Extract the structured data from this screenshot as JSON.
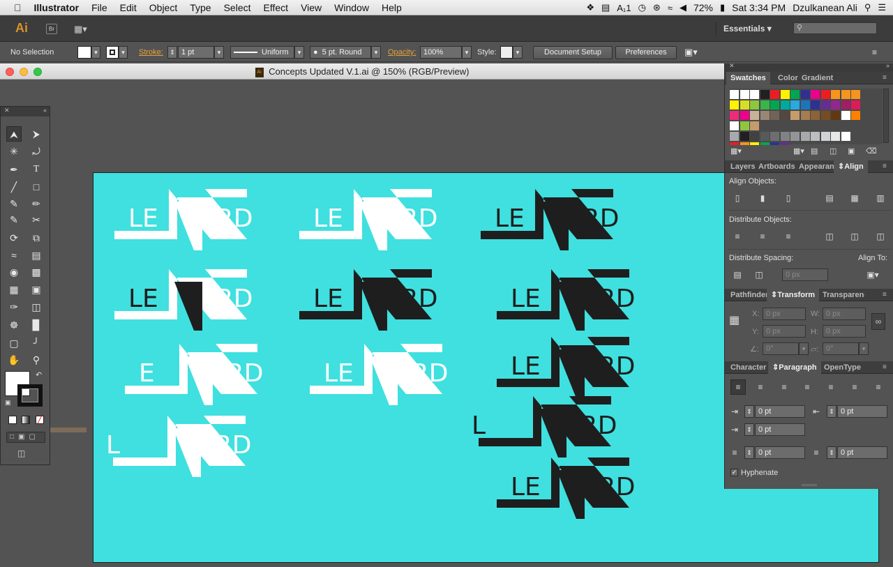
{
  "menubar": {
    "apple": "",
    "app_name": "Illustrator",
    "items": [
      "File",
      "Edit",
      "Object",
      "Type",
      "Select",
      "Effect",
      "View",
      "Window",
      "Help"
    ],
    "adobe_badge": "1",
    "battery": "72%",
    "clock": "Sat 3:34 PM",
    "user": "Dzulkanean Ali"
  },
  "apptop": {
    "logo": "Ai",
    "bridge": "Br",
    "workspace": "Essentials"
  },
  "control": {
    "selection": "No Selection",
    "stroke_label": "Stroke:",
    "stroke_value": "1 pt",
    "profile": "Uniform",
    "brush": "5 pt. Round",
    "opacity_label": "Opacity:",
    "opacity_value": "100%",
    "style_label": "Style:",
    "doc_setup": "Document Setup",
    "preferences": "Preferences"
  },
  "document": {
    "title": "Concepts Updated V.1.ai @ 150% (RGB/Preview)",
    "artboard_color": "#3fe0df"
  },
  "logo_text": {
    "left": "LE",
    "right": "ERD",
    "alt_left": "E",
    "spaced_left": "L"
  },
  "panels": {
    "swatches_tabs": [
      "Swatches",
      "Color",
      "Gradient"
    ],
    "align_tabs": [
      "Layers",
      "Artboards",
      "Appearan",
      "Align"
    ],
    "align_objects": "Align Objects:",
    "distribute_objects": "Distribute Objects:",
    "distribute_spacing": "Distribute Spacing:",
    "align_to": "Align To:",
    "spacing_value": "0 px",
    "transform_tabs": [
      "Pathfinder",
      "Transform",
      "Transparenc"
    ],
    "x_label": "X:",
    "y_label": "Y:",
    "w_label": "W:",
    "h_label": "H:",
    "x_value": "0 px",
    "y_value": "0 px",
    "w_value": "0 px",
    "h_value": "0 px",
    "angle_value": "0°",
    "shear_value": "0°",
    "para_tabs": [
      "Character",
      "Paragraph",
      "OpenType"
    ],
    "indent_left": "0 pt",
    "indent_right": "0 pt",
    "indent_first": "0 pt",
    "space_before": "0 pt",
    "space_after": "0 pt",
    "hyphenate": "Hyphenate"
  }
}
